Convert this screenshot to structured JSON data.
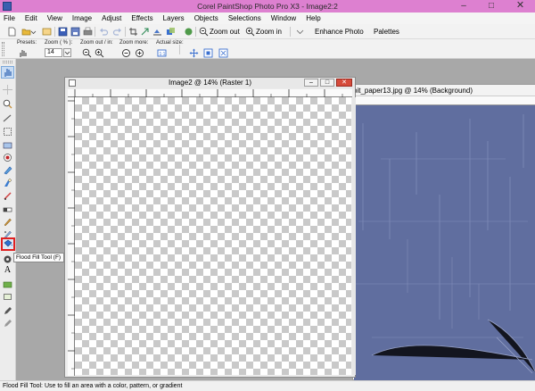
{
  "app": {
    "title": "Corel PaintShop Photo Pro X3 - Image2:2"
  },
  "menu": [
    "File",
    "Edit",
    "View",
    "Image",
    "Adjust",
    "Effects",
    "Layers",
    "Objects",
    "Selections",
    "Window",
    "Help"
  ],
  "toolbar": {
    "zoom_out": "Zoom out",
    "zoom_in": "Zoom in",
    "enhance_photo": "Enhance Photo",
    "palettes": "Palettes"
  },
  "tool_options": {
    "presets_label": "Presets:",
    "zoom_label": "Zoom ( % ):",
    "zoom_value": "14",
    "zoom_out_in_label": "Zoom out / in:",
    "zoom_more_label": "Zoom more:",
    "actual_size_label": "Actual size:"
  },
  "documents": {
    "front_title": "Image2 @  14% (Raster 1)",
    "back_title": "pit_paper13.jpg @  14% (Background)"
  },
  "tooltip": "Flood Fill Tool (F)",
  "status": "Flood Fill Tool: Use to fill an area with a color, pattern, or gradient",
  "colors": {
    "titlebar": "#dd80d0",
    "paper": "#5c6a9c",
    "highlight": "#e02020"
  }
}
